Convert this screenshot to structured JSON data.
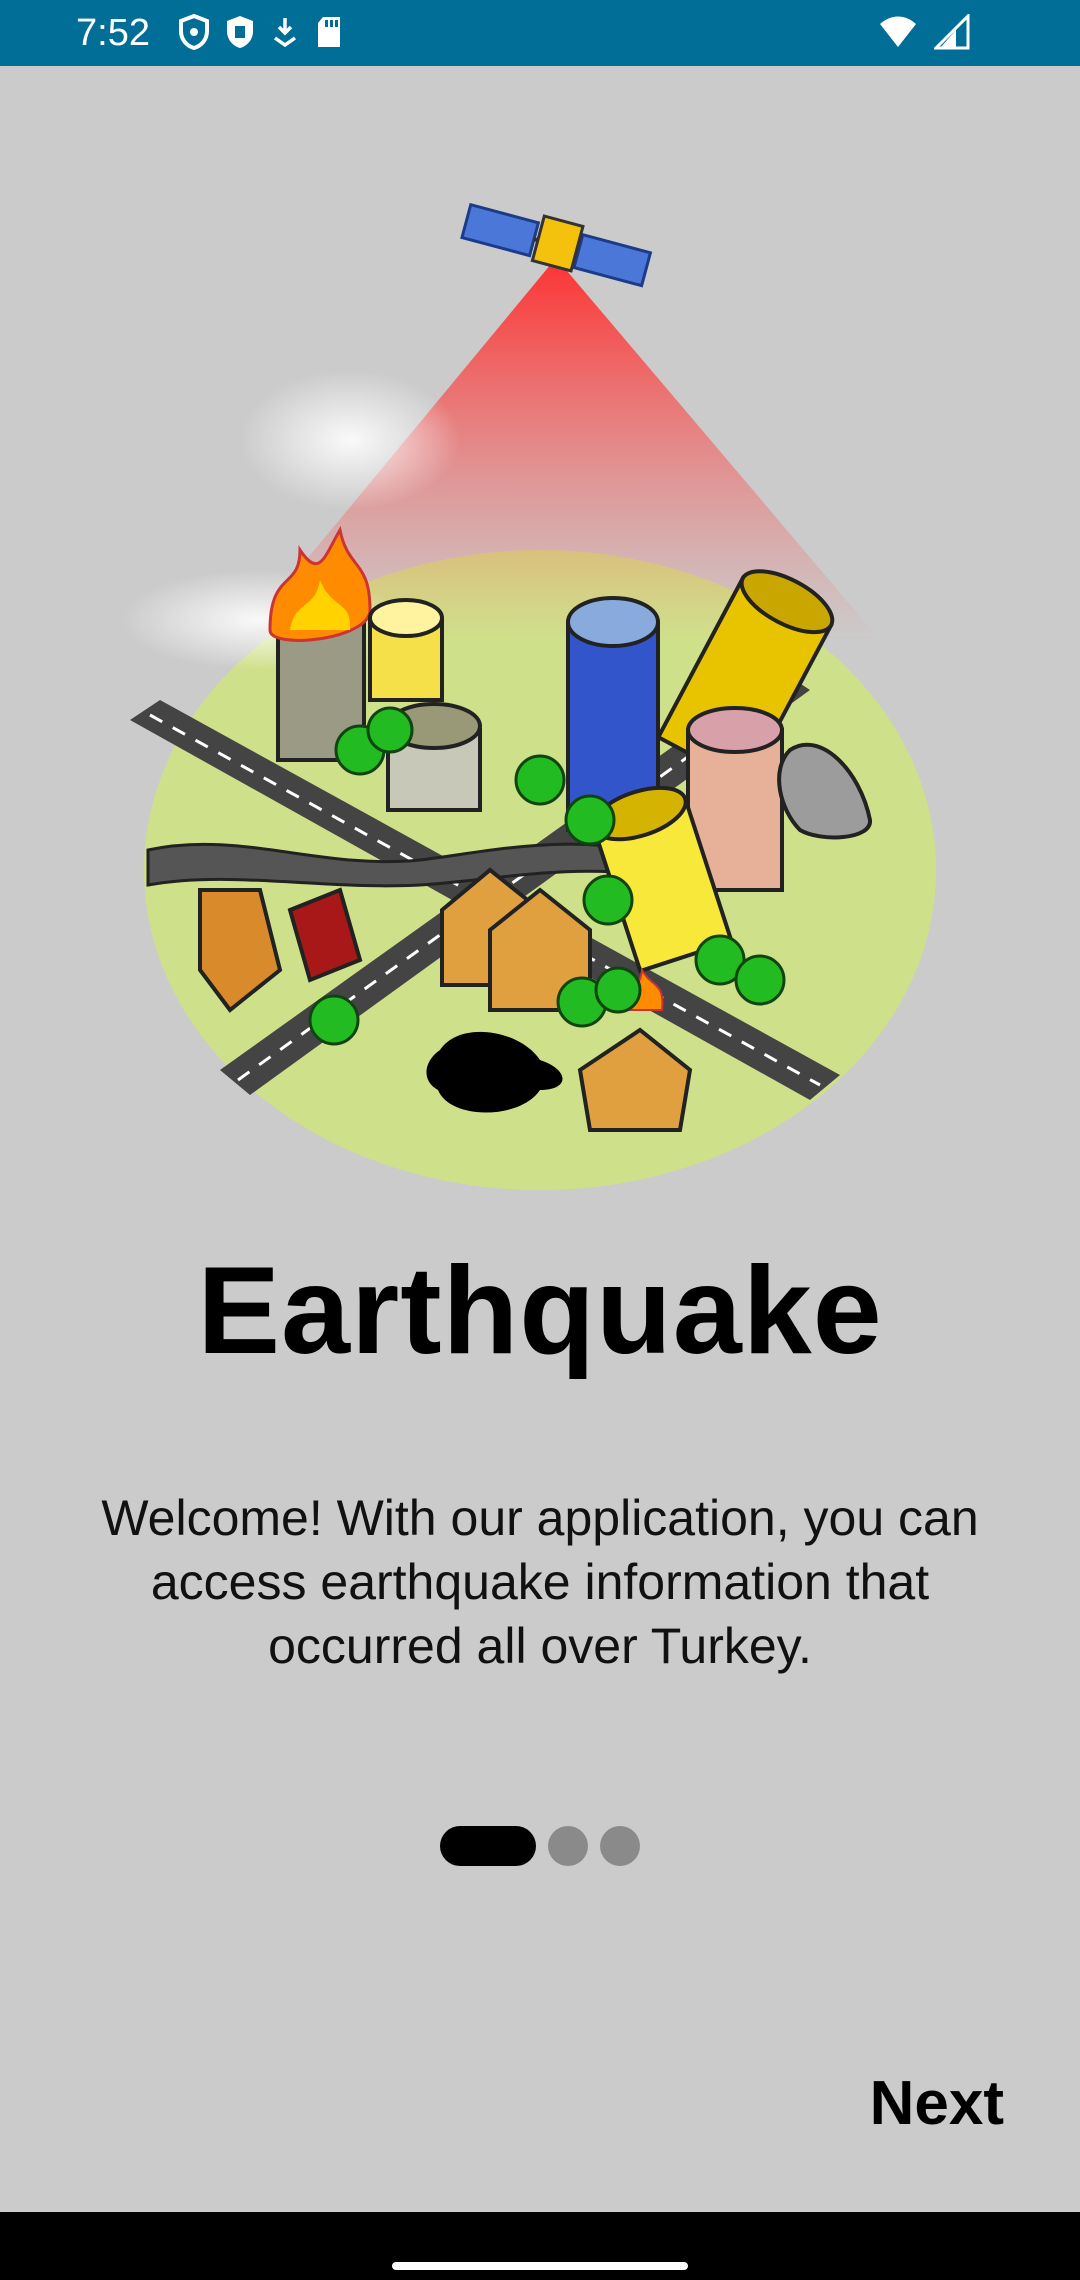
{
  "status_bar": {
    "time": "7:52",
    "left_icons": [
      "shield-outline-icon",
      "shield-filled-icon",
      "download-icon",
      "sd-card-icon"
    ],
    "right_icons": [
      "wifi-icon",
      "signal-icon"
    ],
    "background": "#006e96"
  },
  "onboarding": {
    "illustration": "earthquake-city-satellite-illustration",
    "title": "Earthquake",
    "description": "Welcome! With our application, you can access earthquake information that occurred all over Turkey.",
    "page_indicator": {
      "total": 3,
      "active_index": 0
    },
    "next_label": "Next"
  },
  "colors": {
    "background": "#cbcbcb",
    "text": "#000000",
    "indicator_inactive": "#8a8a8a"
  }
}
